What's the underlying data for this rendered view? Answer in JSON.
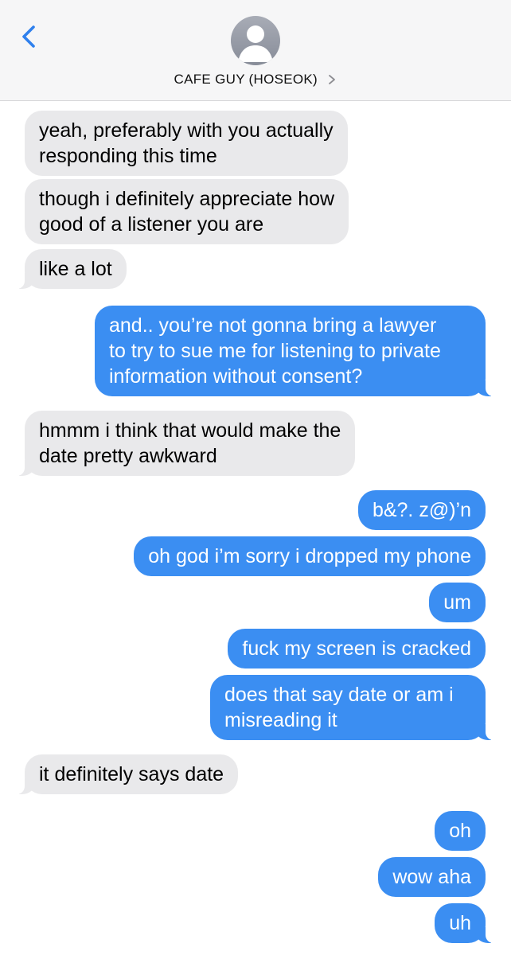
{
  "header": {
    "contact_name": "CAFE GUY (HOSEOK)",
    "back_icon": "chevron-left-icon",
    "avatar_icon": "person-placeholder-icon",
    "disclosure_icon": "chevron-right-icon"
  },
  "colors": {
    "incoming_bubble": "#e9e9eb",
    "outgoing_bubble": "#3b8ef2",
    "accent": "#2f80ed"
  },
  "messages": [
    {
      "sender": "them",
      "lines": [
        "yeah, preferably with you actually",
        "responding this time"
      ]
    },
    {
      "sender": "them",
      "lines": [
        "though i definitely appreciate how",
        "good of a listener you are"
      ]
    },
    {
      "sender": "them",
      "lines": [
        "like a lot"
      ]
    },
    {
      "sender": "me",
      "lines": [
        "and.. you’re not gonna bring a lawyer",
        "to try to sue me for listening to private",
        "information without consent?"
      ]
    },
    {
      "sender": "them",
      "lines": [
        "hmmm i think that would make the",
        "date pretty awkward"
      ]
    },
    {
      "sender": "me",
      "lines": [
        "b&?. z@)’n"
      ]
    },
    {
      "sender": "me",
      "lines": [
        "oh god i’m sorry i dropped my phone"
      ]
    },
    {
      "sender": "me",
      "lines": [
        "um"
      ]
    },
    {
      "sender": "me",
      "lines": [
        "fuck my screen is cracked"
      ]
    },
    {
      "sender": "me",
      "lines": [
        "does that say date or am i",
        "misreading it"
      ]
    },
    {
      "sender": "them",
      "lines": [
        "it definitely says date"
      ]
    },
    {
      "sender": "me",
      "lines": [
        "oh"
      ]
    },
    {
      "sender": "me",
      "lines": [
        "wow aha"
      ]
    },
    {
      "sender": "me",
      "lines": [
        "uh"
      ]
    }
  ]
}
